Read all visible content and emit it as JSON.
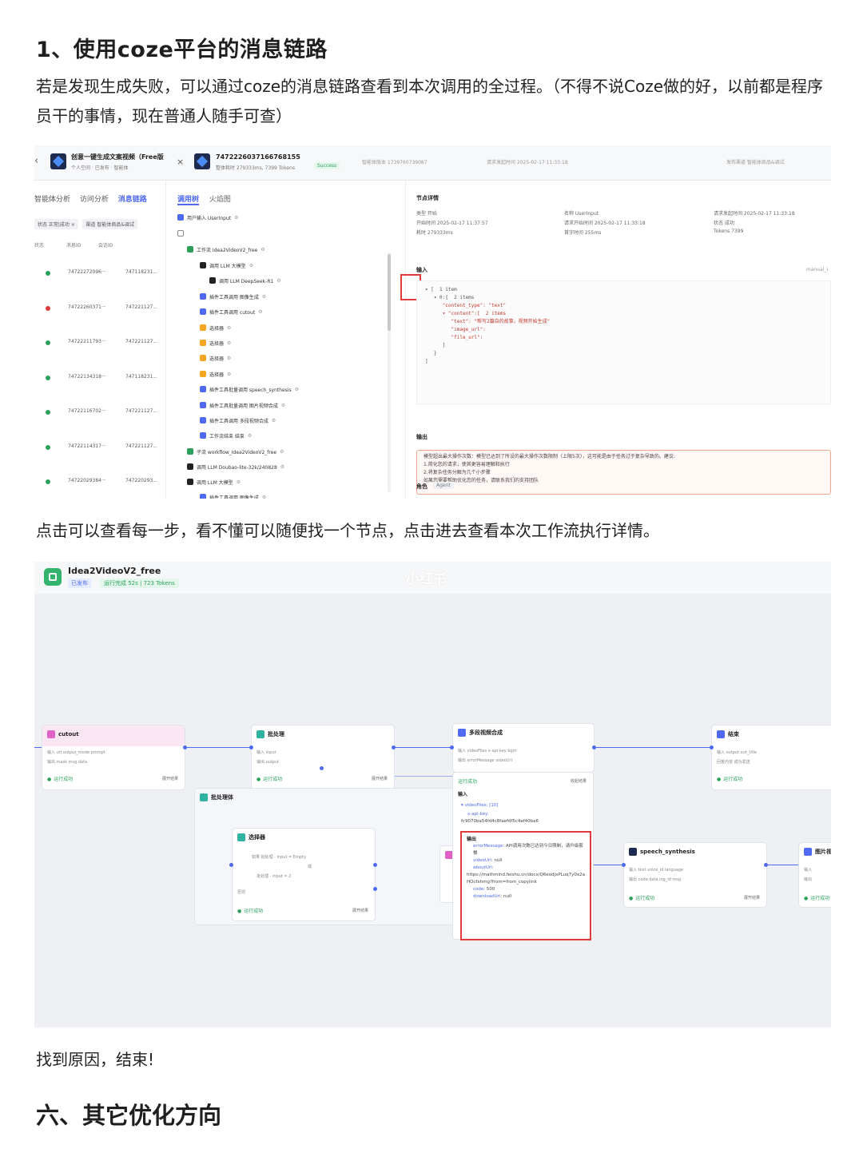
{
  "section1": {
    "heading": "1、使用coze平台的消息链路",
    "paragraph": "若是发现生成失败，可以通过coze的消息链路查看到本次调用的全过程。（不得不说Coze做的好，以前都是程序员干的事情，现在普通人随手可查）"
  },
  "screenshot1": {
    "header": {
      "bot_name": "创意一键生成文案视频（Free版",
      "bot_sub": "个人空间 · 已发布 · 智能体",
      "trace_id": "7472226037166768155",
      "trace_sub": "整体耗时 279333ms, 7399 Tokens",
      "status": "Success",
      "meta1": "智能体版本 1739760739087",
      "meta2": "请求发起时间 2025-02-17 11:33:18",
      "meta3": "发布渠道 智能体商品&调试"
    },
    "left": {
      "tabs": [
        "智能体分析",
        "访问分析",
        "消息链路"
      ],
      "filters": [
        "状态 正常|成功 ×",
        "渠道 智能体商品&调试"
      ],
      "columns": [
        "状态",
        "消息ID",
        "会话ID"
      ],
      "rows": [
        {
          "status": "success",
          "id1": "74722272096···",
          "id2": "747118231..."
        },
        {
          "status": "error",
          "id1": "74722260371···",
          "id2": "747221127..."
        },
        {
          "status": "success",
          "id1": "74722211793···",
          "id2": "747221127..."
        },
        {
          "status": "success",
          "id1": "74722134318···",
          "id2": "747118231..."
        },
        {
          "status": "success",
          "id1": "74722116702···",
          "id2": "747221127..."
        },
        {
          "status": "success",
          "id1": "74722114317···",
          "id2": "747221127..."
        },
        {
          "status": "success",
          "id1": "74722029384···",
          "id2": "747220293..."
        }
      ]
    },
    "middle": {
      "tabs": [
        "调用树",
        "火焰图"
      ],
      "nodes": [
        {
          "icon": "blue",
          "label": "用户输入 UserInput"
        },
        {
          "icon": "outline",
          "label": ""
        },
        {
          "icon": "green",
          "label": "工作流 Idea2VideoV2_free"
        },
        {
          "icon": "black",
          "label": "调用 LLM 大模型"
        },
        {
          "icon": "black",
          "label": "调用 LLM DeepSeek-R1"
        },
        {
          "icon": "blue",
          "label": "插件工具调用 图像生成"
        },
        {
          "icon": "blue",
          "label": "插件工具调用 cutout"
        },
        {
          "icon": "orange",
          "label": "选择器"
        },
        {
          "icon": "orange",
          "label": "选择器"
        },
        {
          "icon": "orange",
          "label": "选择器"
        },
        {
          "icon": "orange",
          "label": "选择器"
        },
        {
          "icon": "blue",
          "label": "插件工具批量调用 speech_synthesis"
        },
        {
          "icon": "blue",
          "label": "插件工具批量调用 图片视频合成"
        },
        {
          "icon": "blue",
          "label": "插件工具调用 多段视频合成"
        },
        {
          "icon": "blue",
          "label": "工作流结束 结束"
        },
        {
          "icon": "green",
          "label": "子流 workflow_Idea2VideoV2_free"
        },
        {
          "icon": "black",
          "label": "调用 LLM Doubao-lite-32k/240828"
        },
        {
          "icon": "black",
          "label": "调用 LLM 大模型"
        },
        {
          "icon": "blue",
          "label": "插件工具调用 图像生成"
        }
      ]
    },
    "right": {
      "title": "节点详情",
      "kv": [
        "类型 开始",
        "开始时间 2025-02-17 11:37:57",
        "耗时 279333ms",
        "名称 UserInput",
        "请求开始时间 2025-02-17 11:33:18",
        "首字时间 255ms",
        "请求发起时间 2025-02-17 11:33:18",
        "状态 成功",
        "Tokens 7399"
      ],
      "input_label": "输入",
      "manual_tag": "manual_i",
      "code_lines": [
        "▾ [  1 item",
        "   ▾ 0:{  2 items",
        "      \"content_type\": \"text\"",
        "      ▾ \"content\":[  2 items",
        "         \"text\": \"帮写2篇自的故事，视频开始生成\"",
        "         \"image_url\":",
        "         \"file_url\":",
        "      ]",
        "   }",
        "]"
      ],
      "output_label": "输出",
      "output_lines": [
        "模型超出最大操作次数：模型已达到了所设的最大操作次数限制（上限5次），这可能是由于任务过于复杂导致的。建议:",
        "1.简化您的请求，使其更容易理解和执行",
        "2.将复杂任务分解为几个小步骤",
        "如果您需要帮助优化您的任务，请联系我们的支持团队"
      ],
      "role_label": "角色",
      "role_value": "Agent"
    }
  },
  "section2": {
    "paragraph": "点击可以查看每一步，看不懂可以随便找一个节点，点击进去查看本次工作流执行详情。"
  },
  "screenshot2": {
    "workflow_name": "Idea2VideoV2_free",
    "published": "已发布",
    "run_status": "运行完成 52s | 723 Tokens",
    "watermark": "小红书",
    "nodes": {
      "cutout": {
        "title": "cutout",
        "row1": "输入  url  output_mode  prompt",
        "row2": "输出  mask  msg  data",
        "status": "运行成功",
        "menu": "展开结果"
      },
      "batch": {
        "title": "批处理",
        "row1": "输入  input",
        "row2": "输出  output",
        "status": "运行成功",
        "menu": "展开结果"
      },
      "merge": {
        "title": "多段视频合成",
        "row1": "输入  videoFiles  x-api-key  bgm",
        "row2": "输出  errorMessage  videoUrl",
        "status": "运行成功",
        "menu": "收起结果"
      },
      "end": {
        "title": "结束",
        "row1": "输入  output  out_title",
        "row2": "回答内容 成功发送",
        "status": "运行成功",
        "menu": "展开结果"
      },
      "batchbody": {
        "title": "批处理体"
      },
      "selector": {
        "title": "选择器",
        "row1": "如果  批处理 - input  =  Empty",
        "row2": "或",
        "row3": "批处理 - input  =  2",
        "row4": "否则",
        "status": "运行成功",
        "menu": "展开结果"
      },
      "speech": {
        "title": "speech_synthesis",
        "row1": "输入  text  voice_id  language",
        "row2": "输出  code  data  log_id  msg",
        "status": "运行成功",
        "menu": "展开结果"
      },
      "imagevideo": {
        "title": "图片视频",
        "row1": "输入",
        "row2": "输出",
        "status": "运行成功"
      }
    },
    "detail": {
      "input_label": "输入",
      "input_line1": "▾ videoFiles: [10]",
      "input_line2": "x-api-key:",
      "input_line3": "fc9070ba54fd4c8faefdf5c4ef40ba6",
      "output_label": "输出",
      "lines": [
        {
          "k": "errorMessage",
          "v": ": API调用次数已达到今日限制，请升级套餐"
        },
        {
          "k": "videoUrl",
          "v": ": null"
        },
        {
          "k": "aboutUrl",
          "v": ":"
        },
        {
          "k": "",
          "v": "https://mathmind.feishu.cn/docx/Q6eodjxPLuq7y0x2aHOcfxhmg?from=from_copylink"
        },
        {
          "k": "code",
          "v": ": 500"
        },
        {
          "k": "downloadUrl",
          "v": ": null"
        }
      ]
    }
  },
  "section3": {
    "paragraph": "找到原因，结束!",
    "heading": "六、其它优化方向"
  }
}
